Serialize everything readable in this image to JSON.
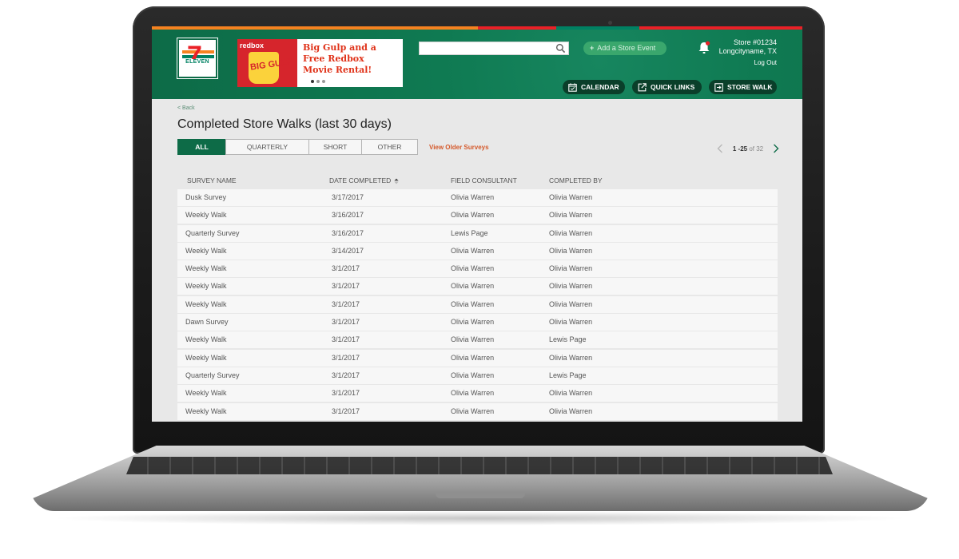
{
  "header": {
    "logo_text": "ELEVEN",
    "logo_number": "7",
    "promo": {
      "brand": "redbox",
      "cup_text": "BIG GULP",
      "headline_lines": [
        "Big Gulp and a",
        "Free Redbox",
        "Movie Rental!"
      ]
    },
    "search": {
      "placeholder": "",
      "value": ""
    },
    "add_event_label": "Add a Store Event",
    "store_number": "Store #01234",
    "store_location": "Longcityname, TX",
    "logout_label": "Log Out",
    "buttons": {
      "calendar": "CALENDAR",
      "quick_links": "QUICK LINKS",
      "store_walk": "STORE WALK"
    }
  },
  "colors": {
    "brand_green": "#0d6b47",
    "accent_orange": "#d55a2c",
    "stripe": [
      "#f58220",
      "#ea2027",
      "#008163"
    ]
  },
  "page": {
    "back_label": "< Back",
    "title": "Completed Store Walks (last 30 days)",
    "filters": [
      "ALL",
      "QUARTERLY",
      "SHORT",
      "OTHER"
    ],
    "active_filter": "ALL",
    "older_surveys_label": "View Older Surveys",
    "pagination": {
      "range": "1 -25",
      "of_label": "of 32"
    }
  },
  "table": {
    "columns": [
      "SURVEY NAME",
      "DATE COMPLETED",
      "FIELD CONSULTANT",
      "COMPLETED BY"
    ],
    "sort_column": "DATE COMPLETED",
    "rows": [
      [
        "Dusk Survey",
        "3/17/2017",
        "Olivia Warren",
        "Olivia Warren"
      ],
      [
        "Weekly Walk",
        "3/16/2017",
        "Olivia Warren",
        "Olivia Warren"
      ],
      [
        "Quarterly Survey",
        "3/16/2017",
        "Lewis Page",
        "Olivia Warren"
      ],
      [
        "Weekly Walk",
        "3/14/2017",
        "Olivia Warren",
        "Olivia Warren"
      ],
      [
        "Weekly Walk",
        "3/1/2017",
        "Olivia Warren",
        "Olivia Warren"
      ],
      [
        "Weekly Walk",
        "3/1/2017",
        "Olivia Warren",
        "Olivia Warren"
      ],
      [
        "Weekly Walk",
        "3/1/2017",
        "Olivia Warren",
        "Olivia Warren"
      ],
      [
        "Dawn Survey",
        "3/1/2017",
        "Olivia Warren",
        "Olivia Warren"
      ],
      [
        "Weekly Walk",
        "3/1/2017",
        "Olivia Warren",
        "Lewis Page"
      ],
      [
        "Weekly Walk",
        "3/1/2017",
        "Olivia Warren",
        "Olivia Warren"
      ],
      [
        "Quarterly Survey",
        "3/1/2017",
        "Olivia Warren",
        "Lewis Page"
      ],
      [
        "Weekly Walk",
        "3/1/2017",
        "Olivia Warren",
        "Olivia Warren"
      ],
      [
        "Weekly Walk",
        "3/1/2017",
        "Olivia Warren",
        "Olivia Warren"
      ]
    ]
  }
}
